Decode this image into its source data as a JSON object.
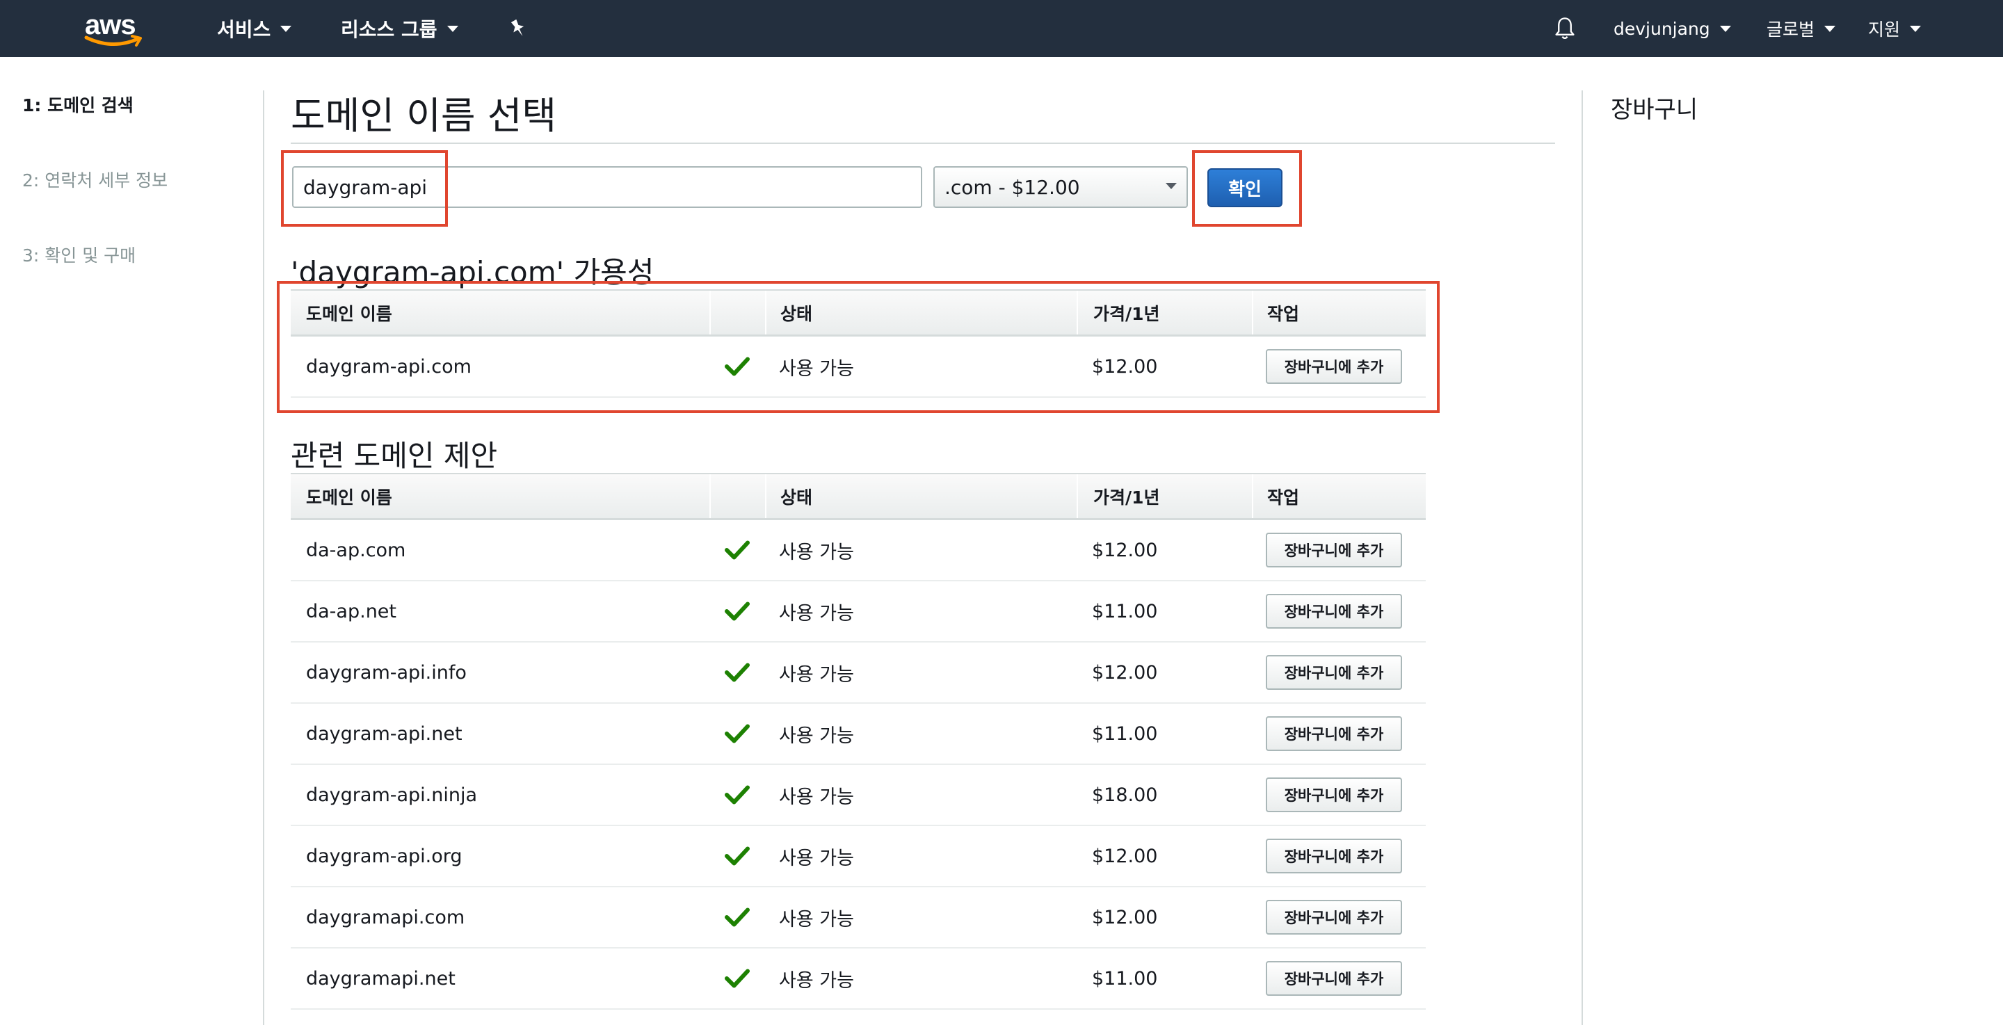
{
  "nav": {
    "logo": "aws",
    "services": "서비스",
    "resource_groups": "리소스 그룹",
    "user": "devjunjang",
    "region": "글로벌",
    "support": "지원"
  },
  "steps": [
    "1: 도메인 검색",
    "2: 연락처 세부 정보",
    "3: 확인 및 구매"
  ],
  "main": {
    "title": "도메인 이름 선택",
    "search_value": "daygram-api",
    "tld_selected": ".com - $12.00",
    "confirm_label": "확인",
    "availability_title": "'daygram-api.com' 가용성",
    "suggestions_title": "관련 도메인 제안"
  },
  "table_headers": [
    "도메인 이름",
    "",
    "상태",
    "가격/1년",
    "작업"
  ],
  "availability_rows": [
    {
      "domain": "daygram-api.com",
      "status": "사용 가능",
      "price": "$12.00",
      "action": "장바구니에 추가"
    }
  ],
  "suggestion_rows": [
    {
      "domain": "da-ap.com",
      "status": "사용 가능",
      "price": "$12.00",
      "action": "장바구니에 추가"
    },
    {
      "domain": "da-ap.net",
      "status": "사용 가능",
      "price": "$11.00",
      "action": "장바구니에 추가"
    },
    {
      "domain": "daygram-api.info",
      "status": "사용 가능",
      "price": "$12.00",
      "action": "장바구니에 추가"
    },
    {
      "domain": "daygram-api.net",
      "status": "사용 가능",
      "price": "$11.00",
      "action": "장바구니에 추가"
    },
    {
      "domain": "daygram-api.ninja",
      "status": "사용 가능",
      "price": "$18.00",
      "action": "장바구니에 추가"
    },
    {
      "domain": "daygram-api.org",
      "status": "사용 가능",
      "price": "$12.00",
      "action": "장바구니에 추가"
    },
    {
      "domain": "daygramapi.com",
      "status": "사용 가능",
      "price": "$12.00",
      "action": "장바구니에 추가"
    },
    {
      "domain": "daygramapi.net",
      "status": "사용 가능",
      "price": "$11.00",
      "action": "장바구니에 추가"
    }
  ],
  "cart": {
    "title": "장바구니"
  },
  "icons": {
    "notifications": "bell-icon",
    "pin": "pin-icon",
    "available": "check-icon"
  },
  "colors": {
    "nav_bg": "#232f3e",
    "primary_button": "#1e5fb0",
    "available_check": "#1d8102",
    "annotation": "#e0462f"
  }
}
